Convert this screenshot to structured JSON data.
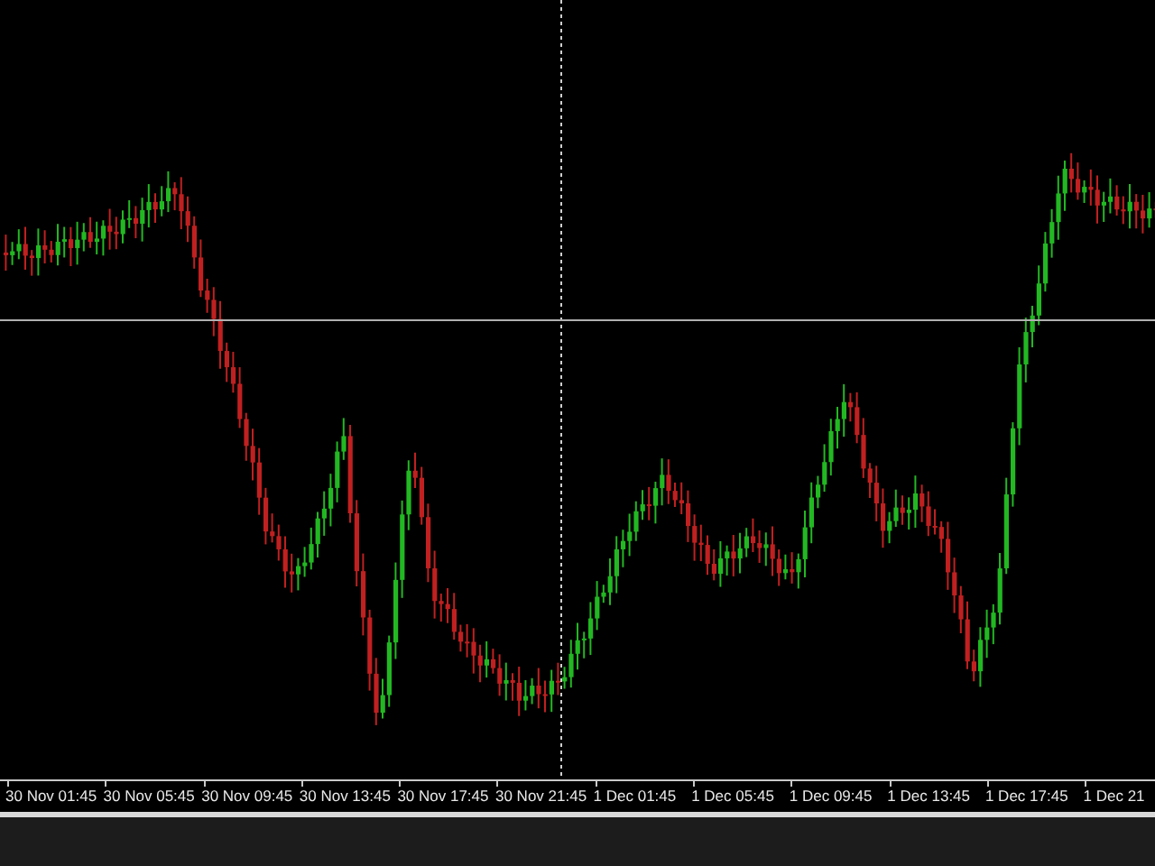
{
  "chart": {
    "x_axis_labels": [
      "30 Nov 01:45",
      "30 Nov 05:45",
      "30 Nov 09:45",
      "30 Nov 13:45",
      "30 Nov 17:45",
      "30 Nov 21:45",
      "1 Dec 01:45",
      "1 Dec 05:45",
      "1 Dec 09:45",
      "1 Dec 13:45",
      "1 Dec 17:45",
      "1 Dec 21"
    ]
  }
}
